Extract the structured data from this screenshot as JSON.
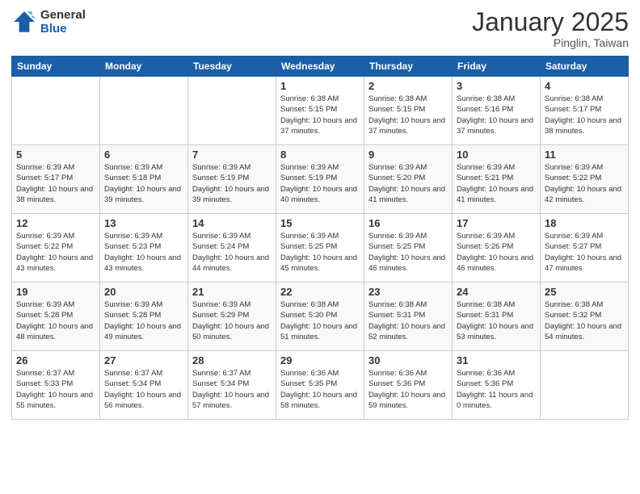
{
  "logo": {
    "line1": "General",
    "line2": "Blue"
  },
  "title": "January 2025",
  "subtitle": "Pinglin, Taiwan",
  "weekdays": [
    "Sunday",
    "Monday",
    "Tuesday",
    "Wednesday",
    "Thursday",
    "Friday",
    "Saturday"
  ],
  "weeks": [
    [
      {
        "day": "",
        "sunrise": "",
        "sunset": "",
        "daylight": ""
      },
      {
        "day": "",
        "sunrise": "",
        "sunset": "",
        "daylight": ""
      },
      {
        "day": "",
        "sunrise": "",
        "sunset": "",
        "daylight": ""
      },
      {
        "day": "1",
        "sunrise": "Sunrise: 6:38 AM",
        "sunset": "Sunset: 5:15 PM",
        "daylight": "Daylight: 10 hours and 37 minutes."
      },
      {
        "day": "2",
        "sunrise": "Sunrise: 6:38 AM",
        "sunset": "Sunset: 5:15 PM",
        "daylight": "Daylight: 10 hours and 37 minutes."
      },
      {
        "day": "3",
        "sunrise": "Sunrise: 6:38 AM",
        "sunset": "Sunset: 5:16 PM",
        "daylight": "Daylight: 10 hours and 37 minutes."
      },
      {
        "day": "4",
        "sunrise": "Sunrise: 6:38 AM",
        "sunset": "Sunset: 5:17 PM",
        "daylight": "Daylight: 10 hours and 38 minutes."
      }
    ],
    [
      {
        "day": "5",
        "sunrise": "Sunrise: 6:39 AM",
        "sunset": "Sunset: 5:17 PM",
        "daylight": "Daylight: 10 hours and 38 minutes."
      },
      {
        "day": "6",
        "sunrise": "Sunrise: 6:39 AM",
        "sunset": "Sunset: 5:18 PM",
        "daylight": "Daylight: 10 hours and 39 minutes."
      },
      {
        "day": "7",
        "sunrise": "Sunrise: 6:39 AM",
        "sunset": "Sunset: 5:19 PM",
        "daylight": "Daylight: 10 hours and 39 minutes."
      },
      {
        "day": "8",
        "sunrise": "Sunrise: 6:39 AM",
        "sunset": "Sunset: 5:19 PM",
        "daylight": "Daylight: 10 hours and 40 minutes."
      },
      {
        "day": "9",
        "sunrise": "Sunrise: 6:39 AM",
        "sunset": "Sunset: 5:20 PM",
        "daylight": "Daylight: 10 hours and 41 minutes."
      },
      {
        "day": "10",
        "sunrise": "Sunrise: 6:39 AM",
        "sunset": "Sunset: 5:21 PM",
        "daylight": "Daylight: 10 hours and 41 minutes."
      },
      {
        "day": "11",
        "sunrise": "Sunrise: 6:39 AM",
        "sunset": "Sunset: 5:22 PM",
        "daylight": "Daylight: 10 hours and 42 minutes."
      }
    ],
    [
      {
        "day": "12",
        "sunrise": "Sunrise: 6:39 AM",
        "sunset": "Sunset: 5:22 PM",
        "daylight": "Daylight: 10 hours and 43 minutes."
      },
      {
        "day": "13",
        "sunrise": "Sunrise: 6:39 AM",
        "sunset": "Sunset: 5:23 PM",
        "daylight": "Daylight: 10 hours and 43 minutes."
      },
      {
        "day": "14",
        "sunrise": "Sunrise: 6:39 AM",
        "sunset": "Sunset: 5:24 PM",
        "daylight": "Daylight: 10 hours and 44 minutes."
      },
      {
        "day": "15",
        "sunrise": "Sunrise: 6:39 AM",
        "sunset": "Sunset: 5:25 PM",
        "daylight": "Daylight: 10 hours and 45 minutes."
      },
      {
        "day": "16",
        "sunrise": "Sunrise: 6:39 AM",
        "sunset": "Sunset: 5:25 PM",
        "daylight": "Daylight: 10 hours and 46 minutes."
      },
      {
        "day": "17",
        "sunrise": "Sunrise: 6:39 AM",
        "sunset": "Sunset: 5:26 PM",
        "daylight": "Daylight: 10 hours and 46 minutes."
      },
      {
        "day": "18",
        "sunrise": "Sunrise: 6:39 AM",
        "sunset": "Sunset: 5:27 PM",
        "daylight": "Daylight: 10 hours and 47 minutes."
      }
    ],
    [
      {
        "day": "19",
        "sunrise": "Sunrise: 6:39 AM",
        "sunset": "Sunset: 5:28 PM",
        "daylight": "Daylight: 10 hours and 48 minutes."
      },
      {
        "day": "20",
        "sunrise": "Sunrise: 6:39 AM",
        "sunset": "Sunset: 5:28 PM",
        "daylight": "Daylight: 10 hours and 49 minutes."
      },
      {
        "day": "21",
        "sunrise": "Sunrise: 6:39 AM",
        "sunset": "Sunset: 5:29 PM",
        "daylight": "Daylight: 10 hours and 50 minutes."
      },
      {
        "day": "22",
        "sunrise": "Sunrise: 6:38 AM",
        "sunset": "Sunset: 5:30 PM",
        "daylight": "Daylight: 10 hours and 51 minutes."
      },
      {
        "day": "23",
        "sunrise": "Sunrise: 6:38 AM",
        "sunset": "Sunset: 5:31 PM",
        "daylight": "Daylight: 10 hours and 52 minutes."
      },
      {
        "day": "24",
        "sunrise": "Sunrise: 6:38 AM",
        "sunset": "Sunset: 5:31 PM",
        "daylight": "Daylight: 10 hours and 53 minutes."
      },
      {
        "day": "25",
        "sunrise": "Sunrise: 6:38 AM",
        "sunset": "Sunset: 5:32 PM",
        "daylight": "Daylight: 10 hours and 54 minutes."
      }
    ],
    [
      {
        "day": "26",
        "sunrise": "Sunrise: 6:37 AM",
        "sunset": "Sunset: 5:33 PM",
        "daylight": "Daylight: 10 hours and 55 minutes."
      },
      {
        "day": "27",
        "sunrise": "Sunrise: 6:37 AM",
        "sunset": "Sunset: 5:34 PM",
        "daylight": "Daylight: 10 hours and 56 minutes."
      },
      {
        "day": "28",
        "sunrise": "Sunrise: 6:37 AM",
        "sunset": "Sunset: 5:34 PM",
        "daylight": "Daylight: 10 hours and 57 minutes."
      },
      {
        "day": "29",
        "sunrise": "Sunrise: 6:36 AM",
        "sunset": "Sunset: 5:35 PM",
        "daylight": "Daylight: 10 hours and 58 minutes."
      },
      {
        "day": "30",
        "sunrise": "Sunrise: 6:36 AM",
        "sunset": "Sunset: 5:36 PM",
        "daylight": "Daylight: 10 hours and 59 minutes."
      },
      {
        "day": "31",
        "sunrise": "Sunrise: 6:36 AM",
        "sunset": "Sunset: 5:36 PM",
        "daylight": "Daylight: 11 hours and 0 minutes."
      },
      {
        "day": "",
        "sunrise": "",
        "sunset": "",
        "daylight": ""
      }
    ]
  ]
}
